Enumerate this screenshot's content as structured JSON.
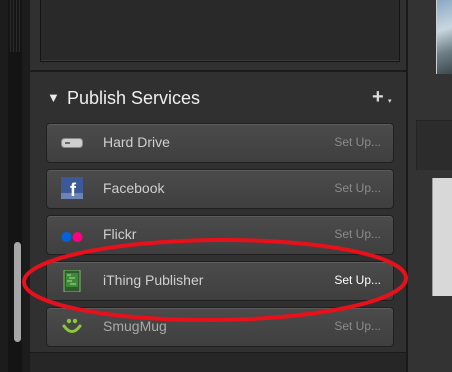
{
  "panel": {
    "header": {
      "title": "Publish Services",
      "add_symbol": "+",
      "add_caret": "▾",
      "collapse_symbol": "▼"
    },
    "services": [
      {
        "label": "Hard Drive",
        "action": "Set Up...",
        "icon": "hard-drive-icon",
        "highlight": false
      },
      {
        "label": "Facebook",
        "action": "Set Up...",
        "icon": "facebook-icon",
        "highlight": false
      },
      {
        "label": "Flickr",
        "action": "Set Up...",
        "icon": "flickr-icon",
        "highlight": false
      },
      {
        "label": "iThing Publisher",
        "action": "Set Up...",
        "icon": "ithing-publisher-icon",
        "highlight": true
      },
      {
        "label": "SmugMug",
        "action": "Set Up...",
        "icon": "smugmug-icon",
        "highlight": false
      }
    ]
  },
  "colors": {
    "annotation_ring": "#e8101a",
    "facebook_blue": "#3b5998",
    "flickr_blue": "#0063dc",
    "flickr_pink": "#ff0084",
    "smugmug_green": "#8dc63f"
  }
}
